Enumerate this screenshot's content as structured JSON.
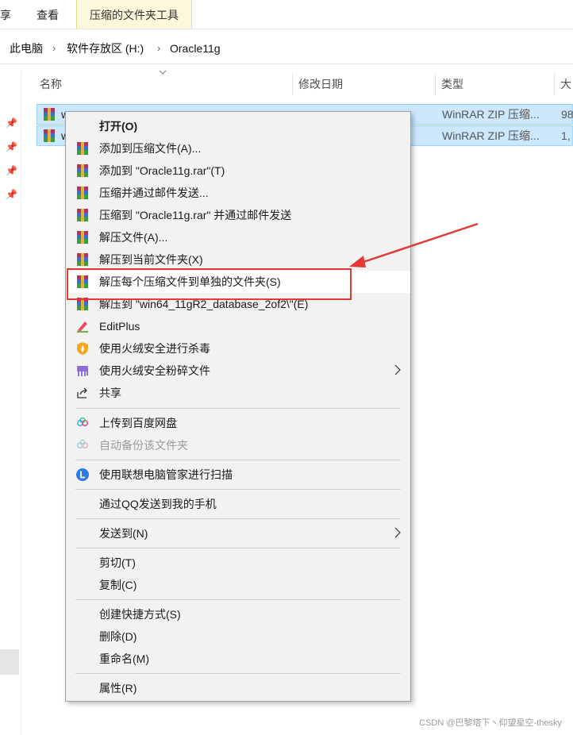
{
  "ribbon": {
    "tabs": [
      {
        "label": "享",
        "active": false
      },
      {
        "label": "查看",
        "active": false
      },
      {
        "label": "压缩的文件夹工具",
        "active": true
      }
    ]
  },
  "breadcrumb": {
    "items": [
      "此电脑",
      "软件存放区 (H:)",
      "Oracle11g"
    ]
  },
  "columns": {
    "name": "名称",
    "date": "修改日期",
    "type": "类型",
    "size": "大"
  },
  "files": [
    {
      "name": "w",
      "type": "WinRAR ZIP 压缩...",
      "size": "98"
    },
    {
      "name": "w",
      "type": "WinRAR ZIP 压缩...",
      "size": "1,"
    }
  ],
  "menu": {
    "items": [
      {
        "label": "打开(O)",
        "icon": "none",
        "bold": true
      },
      {
        "label": "添加到压缩文件(A)...",
        "icon": "winrar-icon"
      },
      {
        "label": "添加到 \"Oracle11g.rar\"(T)",
        "icon": "winrar-icon"
      },
      {
        "label": "压缩并通过邮件发送...",
        "icon": "winrar-icon"
      },
      {
        "label": "压缩到 \"Oracle11g.rar\" 并通过邮件发送",
        "icon": "winrar-icon"
      },
      {
        "label": "解压文件(A)...",
        "icon": "winrar-icon"
      },
      {
        "label": "解压到当前文件夹(X)",
        "icon": "winrar-icon"
      },
      {
        "label": "解压每个压缩文件到单独的文件夹(S)",
        "icon": "winrar-icon",
        "highlighted": true
      },
      {
        "label": "解压到 \"win64_11gR2_database_2of2\\\"(E)",
        "icon": "winrar-icon"
      },
      {
        "label": "EditPlus",
        "icon": "editplus-icon"
      },
      {
        "label": "使用火绒安全进行杀毒",
        "icon": "huorong-shield-icon"
      },
      {
        "label": "使用火绒安全粉碎文件",
        "icon": "shredder-icon",
        "submenu": true
      },
      {
        "label": "共享",
        "icon": "share-icon"
      },
      {
        "label": "上传到百度网盘",
        "icon": "baidu-cloud-icon"
      },
      {
        "label": "自动备份该文件夹",
        "icon": "baidu-cloud-icon",
        "disabled": true
      },
      {
        "label": "使用联想电脑管家进行扫描",
        "icon": "lenovo-icon"
      },
      {
        "label": "通过QQ发送到我的手机",
        "icon": "none"
      },
      {
        "label": "发送到(N)",
        "icon": "none",
        "submenu": true
      },
      {
        "label": "剪切(T)",
        "icon": "none"
      },
      {
        "label": "复制(C)",
        "icon": "none"
      },
      {
        "label": "创建快捷方式(S)",
        "icon": "none"
      },
      {
        "label": "删除(D)",
        "icon": "none"
      },
      {
        "label": "重命名(M)",
        "icon": "none"
      },
      {
        "label": "属性(R)",
        "icon": "none"
      }
    ]
  },
  "watermark": "CSDN @巴黎塔下丶仰望星空-thesky",
  "colors": {
    "selection": "#cce8ff",
    "menu_bg": "#f2f2f2",
    "annotation_red": "#e53935"
  }
}
